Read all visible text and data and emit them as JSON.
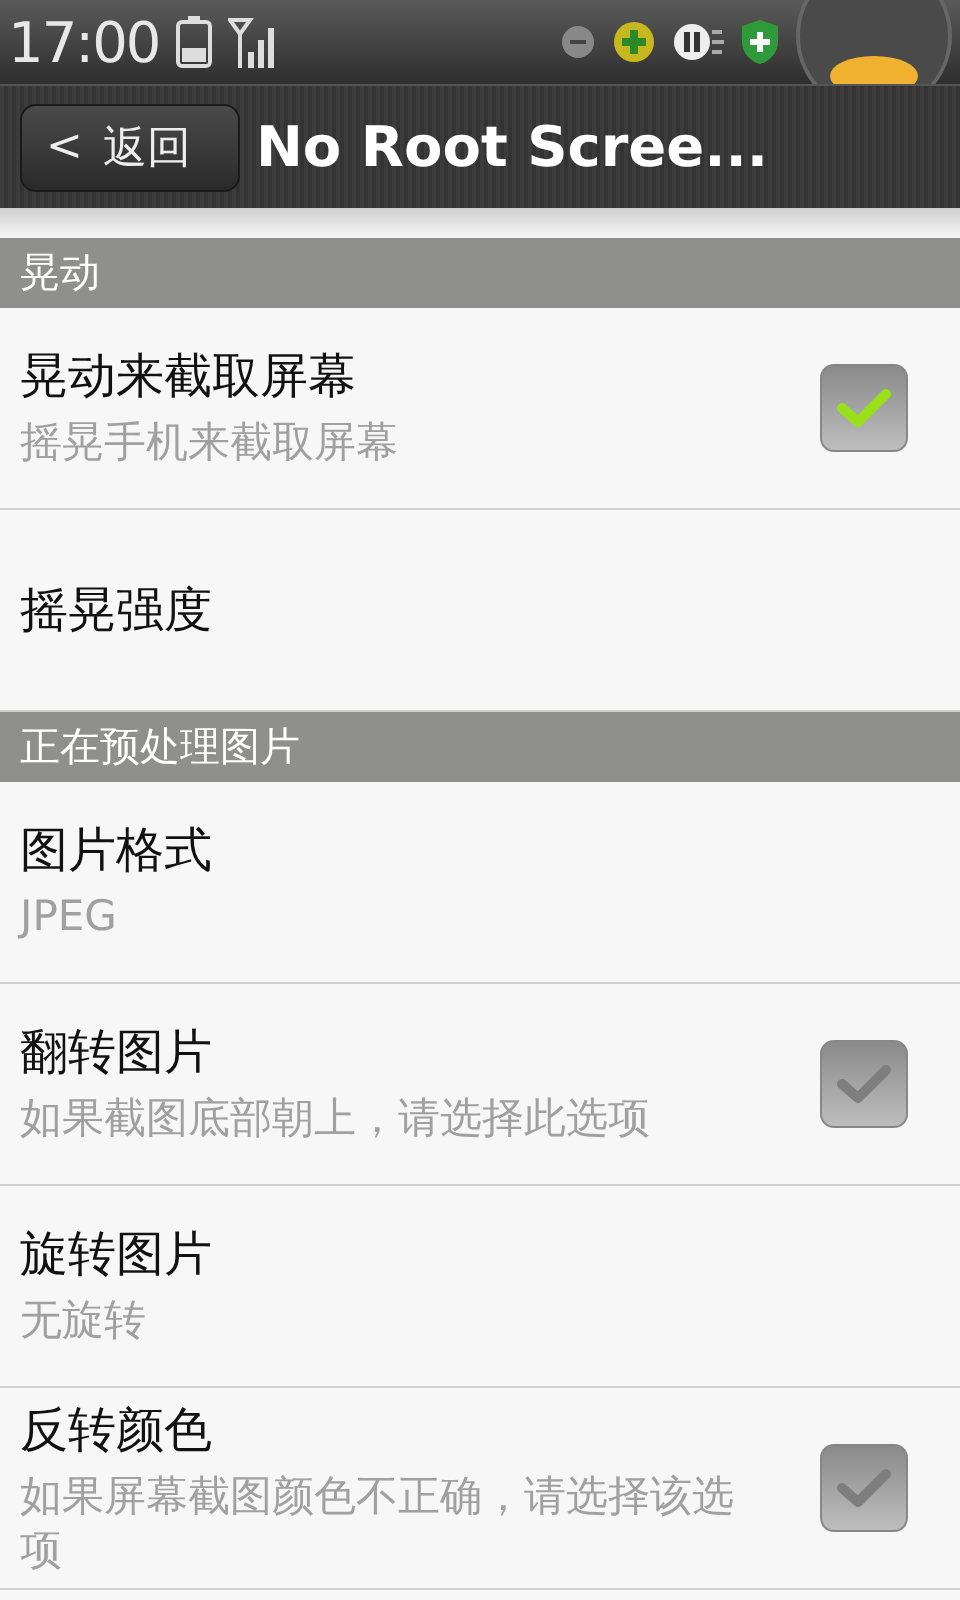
{
  "status_bar": {
    "time": "17:00"
  },
  "action_bar": {
    "back_label": "返回",
    "back_glyph": "<",
    "title": "No Root Scree..."
  },
  "sections": [
    {
      "header": "晃动",
      "items": [
        {
          "kind": "checkbox",
          "title": "晃动来截取屏幕",
          "summary": "摇晃手机来截取屏幕",
          "checked": true
        },
        {
          "kind": "plain",
          "title": "摇晃强度"
        }
      ]
    },
    {
      "header": "正在预处理图片",
      "items": [
        {
          "kind": "plain",
          "title": "图片格式",
          "summary": "JPEG"
        },
        {
          "kind": "checkbox",
          "title": "翻转图片",
          "summary": "如果截图底部朝上，请选择此选项",
          "checked": false
        },
        {
          "kind": "plain",
          "title": "旋转图片",
          "summary": "无旋转"
        },
        {
          "kind": "checkbox",
          "title": "反转颜色",
          "summary": "如果屏幕截图颜色不正确，请选择该选项",
          "checked": false
        }
      ]
    }
  ]
}
